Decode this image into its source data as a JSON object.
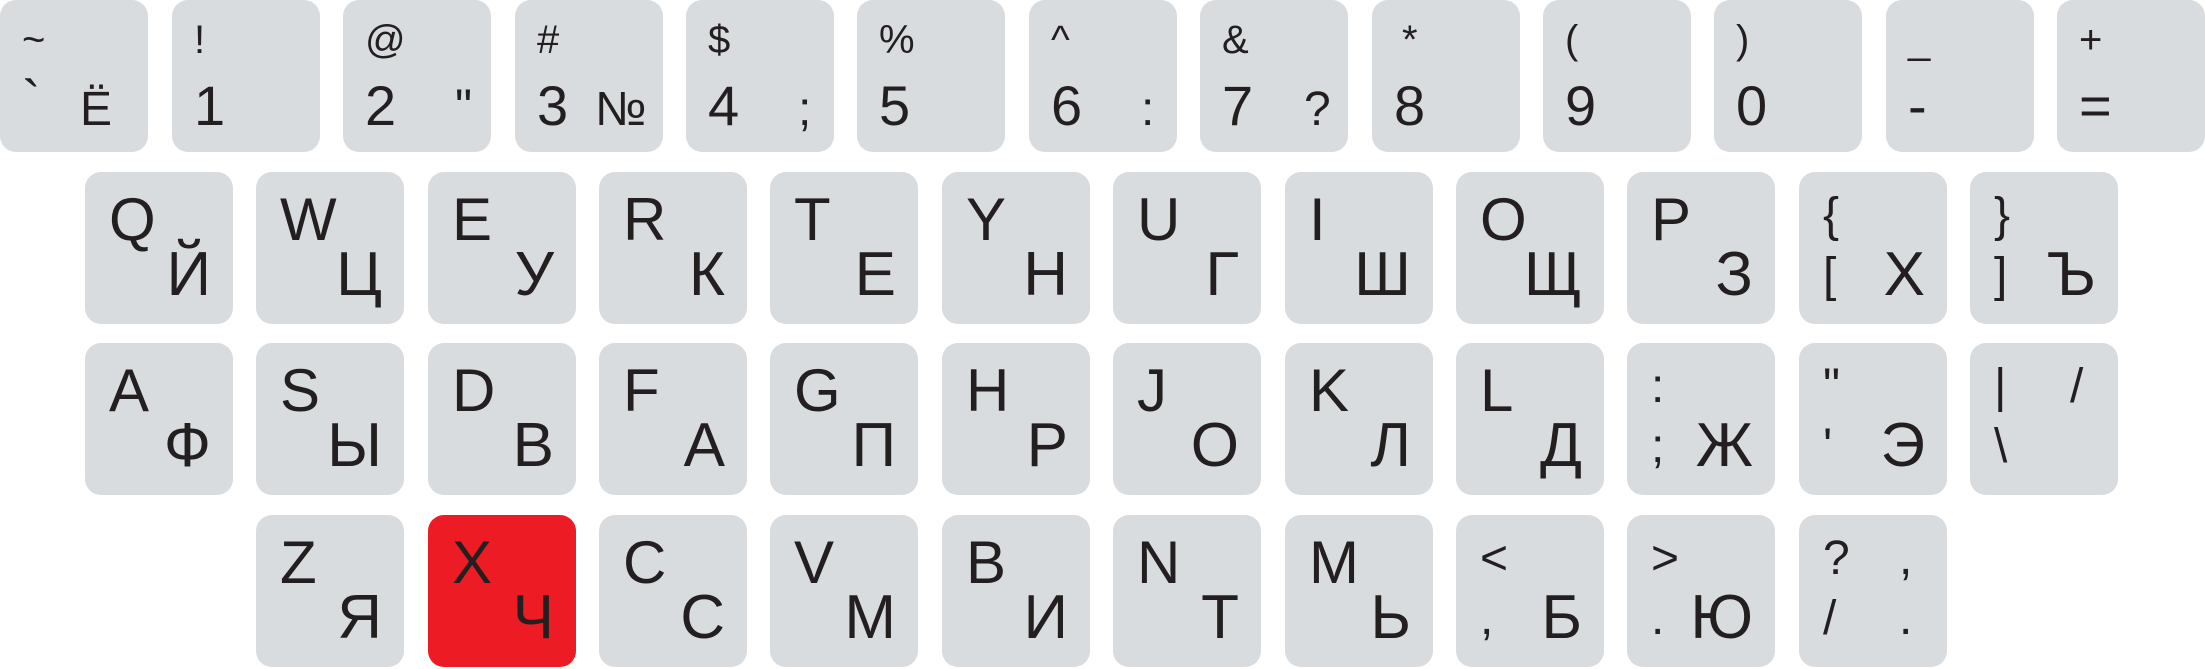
{
  "accent_color": "#ed1c24",
  "key_color": "#d9dcdf",
  "highlighted_key": "X",
  "row1": [
    {
      "shift": "~",
      "main": "`",
      "ru": "Ё"
    },
    {
      "shift": "!",
      "main": "1",
      "ru": ""
    },
    {
      "shift": "@",
      "main": "2",
      "ru": "\""
    },
    {
      "shift": "#",
      "main": "3",
      "ru": "№"
    },
    {
      "shift": "$",
      "main": "4",
      "ru": ";"
    },
    {
      "shift": "%",
      "main": "5",
      "ru": ""
    },
    {
      "shift": "^",
      "main": "6",
      "ru": ":"
    },
    {
      "shift": "&",
      "main": "7",
      "ru": "?"
    },
    {
      "shift": "*",
      "main": "8",
      "ru": ""
    },
    {
      "shift": "(",
      "main": "9",
      "ru": ""
    },
    {
      "shift": ")",
      "main": "0",
      "ru": ""
    },
    {
      "shift": "_",
      "main": "-",
      "ru": ""
    },
    {
      "shift": "+",
      "main": "=",
      "ru": ""
    }
  ],
  "row2": [
    {
      "lat": "Q",
      "cyr": "Й"
    },
    {
      "lat": "W",
      "cyr": "Ц"
    },
    {
      "lat": "E",
      "cyr": "У"
    },
    {
      "lat": "R",
      "cyr": "К"
    },
    {
      "lat": "T",
      "cyr": "Е"
    },
    {
      "lat": "Y",
      "cyr": "Н"
    },
    {
      "lat": "U",
      "cyr": "Г"
    },
    {
      "lat": "I",
      "cyr": "Ш"
    },
    {
      "lat": "O",
      "cyr": "Щ"
    },
    {
      "lat": "P",
      "cyr": "З"
    },
    {
      "tl": "{",
      "bl": "[",
      "cyr": "Х"
    },
    {
      "tl": "}",
      "bl": "]",
      "cyr": "Ъ"
    }
  ],
  "row3": [
    {
      "lat": "A",
      "cyr": "Ф"
    },
    {
      "lat": "S",
      "cyr": "Ы"
    },
    {
      "lat": "D",
      "cyr": "В"
    },
    {
      "lat": "F",
      "cyr": "А"
    },
    {
      "lat": "G",
      "cyr": "П"
    },
    {
      "lat": "H",
      "cyr": "Р"
    },
    {
      "lat": "J",
      "cyr": "О"
    },
    {
      "lat": "K",
      "cyr": "Л"
    },
    {
      "lat": "L",
      "cyr": "Д"
    },
    {
      "tl": ":",
      "bl": ";",
      "cyr": "Ж"
    },
    {
      "tl": "\"",
      "bl": "'",
      "cyr": "Э"
    },
    {
      "tl": "|",
      "bl": "\\",
      "tr": "/"
    }
  ],
  "row4": [
    {
      "lat": "Z",
      "cyr": "Я"
    },
    {
      "lat": "X",
      "cyr": "Ч"
    },
    {
      "lat": "C",
      "cyr": "С"
    },
    {
      "lat": "V",
      "cyr": "М"
    },
    {
      "lat": "B",
      "cyr": "И"
    },
    {
      "lat": "N",
      "cyr": "Т"
    },
    {
      "lat": "M",
      "cyr": "Ь"
    },
    {
      "tl": "<",
      "bl": ",",
      "cyr": "Б"
    },
    {
      "tl": ">",
      "bl": ".",
      "cyr": "Ю"
    },
    {
      "tl": "?",
      "bl": "/",
      "tr": ",",
      "br": "."
    }
  ]
}
